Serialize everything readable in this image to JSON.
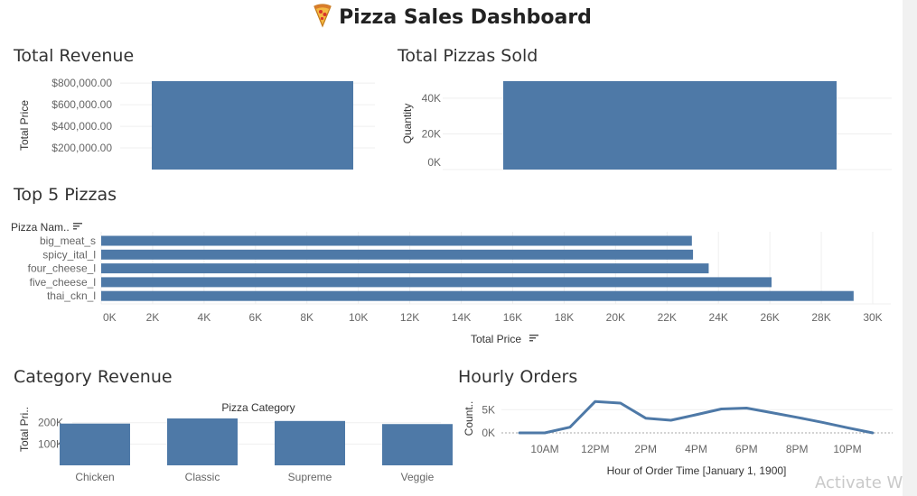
{
  "dashboard": {
    "title": "Pizza Sales Dashboard",
    "title_icon": "pizza-icon",
    "watermark": "Activate Wind"
  },
  "colors": {
    "bar": "#4e79a7",
    "grid": "#efefef",
    "axis_text": "#666666",
    "title_text": "#333333"
  },
  "sections": {
    "total_revenue": "Total Revenue",
    "total_pizzas": "Total Pizzas Sold",
    "top5": "Top 5 Pizzas",
    "category": "Category Revenue",
    "hourly": "Hourly Orders"
  },
  "chart_data": [
    {
      "id": "total_revenue",
      "type": "bar",
      "title": "Total Revenue",
      "ylabel": "Total Price",
      "yticks": [
        "$200,000.00",
        "$400,000.00",
        "$600,000.00",
        "$800,000.00"
      ],
      "ytick_values": [
        200000,
        400000,
        600000,
        800000
      ],
      "ylim": [
        0,
        817860
      ],
      "values": [
        817860
      ]
    },
    {
      "id": "total_pizzas",
      "type": "bar",
      "title": "Total Pizzas Sold",
      "ylabel": "Quantity",
      "yticks": [
        "0K",
        "20K",
        "40K"
      ],
      "ytick_values": [
        0,
        20000,
        40000
      ],
      "ylim": [
        0,
        49574
      ],
      "values": [
        49574
      ]
    },
    {
      "id": "top5",
      "type": "bar",
      "orientation": "horizontal",
      "title": "Top 5 Pizzas",
      "ylabel": "Pizza Nam..",
      "xlabel": "Total Price",
      "categories": [
        "big_meat_s",
        "spicy_ital_l",
        "four_cheese_l",
        "five_cheese_l",
        "thai_ckn_l"
      ],
      "values": [
        22968,
        23012,
        23622,
        26066,
        29257
      ],
      "xticks": [
        "0K",
        "2K",
        "4K",
        "6K",
        "8K",
        "10K",
        "12K",
        "14K",
        "16K",
        "18K",
        "20K",
        "22K",
        "24K",
        "26K",
        "28K",
        "30K"
      ],
      "xlim": [
        0,
        30000
      ]
    },
    {
      "id": "category",
      "type": "bar",
      "title": "Category Revenue",
      "header": "Pizza Category",
      "ylabel": "Total Pri..",
      "categories": [
        "Chicken",
        "Classic",
        "Supreme",
        "Veggie"
      ],
      "values": [
        195920,
        220053,
        208197,
        193690
      ],
      "yticks": [
        "100K",
        "200K"
      ],
      "ytick_values": [
        100000,
        200000
      ],
      "ylim": [
        0,
        220053
      ]
    },
    {
      "id": "hourly",
      "type": "line",
      "title": "Hourly Orders",
      "ylabel": "Count..",
      "xlabel": "Hour of Order Time [January 1, 1900]",
      "x": [
        9,
        10,
        11,
        12,
        13,
        14,
        15,
        16,
        17,
        18,
        19,
        20,
        21,
        22,
        23
      ],
      "values": [
        1,
        8,
        1231,
        6776,
        6413,
        3170,
        2728,
        3911,
        5157,
        5353,
        4349,
        3342,
        2267,
        1099,
        0
      ],
      "xticks": [
        "10AM",
        "12PM",
        "2PM",
        "4PM",
        "6PM",
        "8PM",
        "10PM"
      ],
      "xtick_values": [
        10,
        12,
        14,
        16,
        18,
        20,
        22
      ],
      "yticks": [
        "0K",
        "5K"
      ],
      "ytick_values": [
        0,
        5000
      ],
      "ylim": [
        0,
        7000
      ]
    }
  ]
}
